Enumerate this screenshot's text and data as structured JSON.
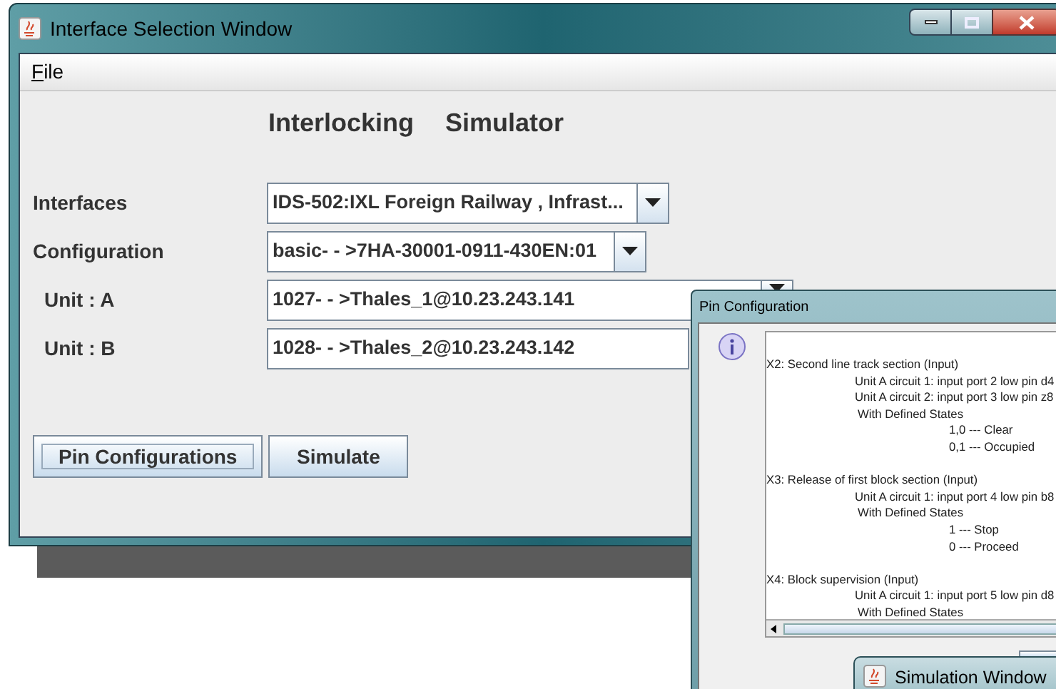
{
  "main_window": {
    "title": "Interface Selection Window",
    "menu": [
      {
        "label": "File"
      }
    ],
    "heading": [
      "Interlocking",
      "Simulator"
    ],
    "fields": [
      {
        "label": "Interfaces",
        "value": "IDS-502:IXL Foreign Railway , Infrast...",
        "indent": false
      },
      {
        "label": "Configuration",
        "value": "basic- - >7HA-30001-0911-430EN:01",
        "indent": false
      },
      {
        "label": "Unit : A",
        "value": "1027- - >Thales_1@10.23.243.141",
        "indent": true
      },
      {
        "label": "Unit : B",
        "value": "1028- - >Thales_2@10.23.243.142",
        "indent": true
      }
    ],
    "buttons": [
      {
        "label": "Pin Configurations",
        "focused": true
      },
      {
        "label": "Simulate",
        "focused": false
      }
    ]
  },
  "dialog": {
    "title": "Pin Configuration",
    "sections": [
      {
        "heading": "X2: Second line track section (Input)",
        "ports": [
          "Unit A circuit 1: input port 2 low pin d4",
          "Unit A circuit 2: input port 3 low pin z8"
        ],
        "states_label": "With Defined States",
        "states": [
          "1,0 --- Clear",
          "0,1 --- Occupied"
        ]
      },
      {
        "heading": "X3: Release of first block section (Input)",
        "ports": [
          "Unit A circuit 1: input port 4 low pin b8"
        ],
        "states_label": "With Defined States",
        "states": [
          "1 --- Stop",
          "0 --- Proceed"
        ]
      },
      {
        "heading": "X4: Block supervision (Input)",
        "ports": [
          "Unit A circuit 1: input port 5 low pin d8"
        ],
        "states_label": "With Defined States"
      }
    ]
  },
  "simulation_window": {
    "title": "Simulation Window"
  }
}
